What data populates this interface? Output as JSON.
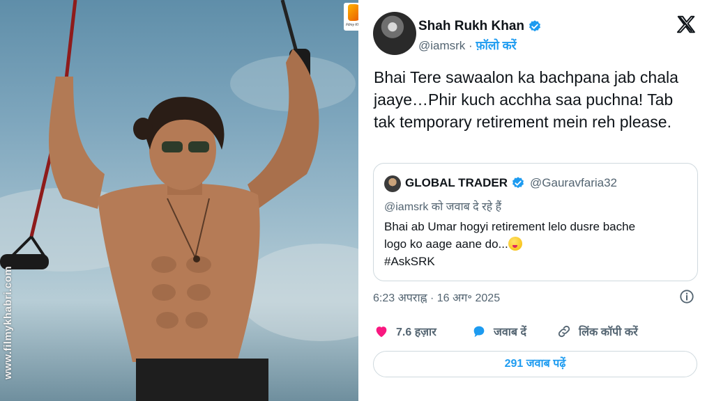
{
  "photo": {
    "watermark": "www.filmykhabri.com"
  },
  "logo": {
    "text": "Filmy Khabri"
  },
  "tweet": {
    "author_name": "Shah Rukh Khan",
    "handle": "@iamsrk",
    "separator": " · ",
    "follow_label": "फ़ॉलो करें",
    "text": "Bhai Tere sawaalon ka bachpana jab chala jaaye…Phir kuch acchha saa puchna! Tab tak temporary retirement mein reh please.",
    "timestamp": "6:23 अपराह्न · 16 अग॰ 2025",
    "likes": "7.6 हज़ार",
    "reply_label": "जवाब दें",
    "copy_link_label": "लिंक कॉपी करें",
    "read_replies_label": "291 जवाब पढ़ें"
  },
  "quote": {
    "author_name": "GLOBAL TRADER",
    "handle": "@Gauravfaria32",
    "replying_to": "@iamsrk को जवाब दे रहे हैं",
    "body_line1": "Bhai ab Umar hogyi retirement lelo dusre bache",
    "body_line2": "logo ko aage aane do...",
    "hashtag": "#AskSRK"
  },
  "icons": {
    "verified": "verified-badge-icon",
    "x_logo": "x-logo-icon",
    "info": "info-icon",
    "like": "heart-icon",
    "reply": "reply-bubble-icon",
    "copy_link": "link-icon",
    "emoji": "zany-face-emoji"
  },
  "colors": {
    "accent": "#1d9bf0",
    "like": "#f91880",
    "text": "#0f1419",
    "muted": "#536471",
    "border": "#cfd9de"
  }
}
